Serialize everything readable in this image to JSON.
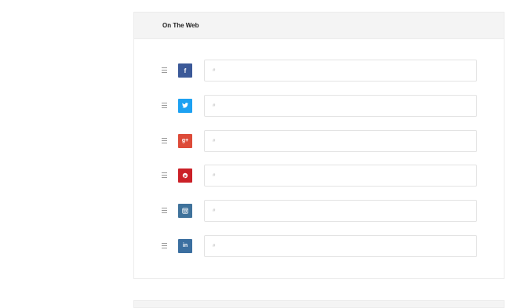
{
  "panel": {
    "title": "On The Web"
  },
  "links": [
    {
      "network": "facebook",
      "icon": "facebook-icon",
      "glyph": "f",
      "color": "#3b5998",
      "placeholder": "#"
    },
    {
      "network": "twitter",
      "icon": "twitter-icon",
      "glyph": "",
      "color": "#1da1f2",
      "placeholder": "#"
    },
    {
      "network": "google-plus",
      "icon": "google-plus-icon",
      "glyph": "g+",
      "color": "#dd4b39",
      "placeholder": "#"
    },
    {
      "network": "pinterest",
      "icon": "pinterest-icon",
      "glyph": "p",
      "color": "#cb2027",
      "placeholder": "#"
    },
    {
      "network": "instagram",
      "icon": "instagram-icon",
      "glyph": "",
      "color": "#3f729b",
      "placeholder": "#"
    },
    {
      "network": "linkedin",
      "icon": "linkedin-icon",
      "glyph": "in",
      "color": "#0e76a8",
      "placeholder": "#"
    }
  ]
}
